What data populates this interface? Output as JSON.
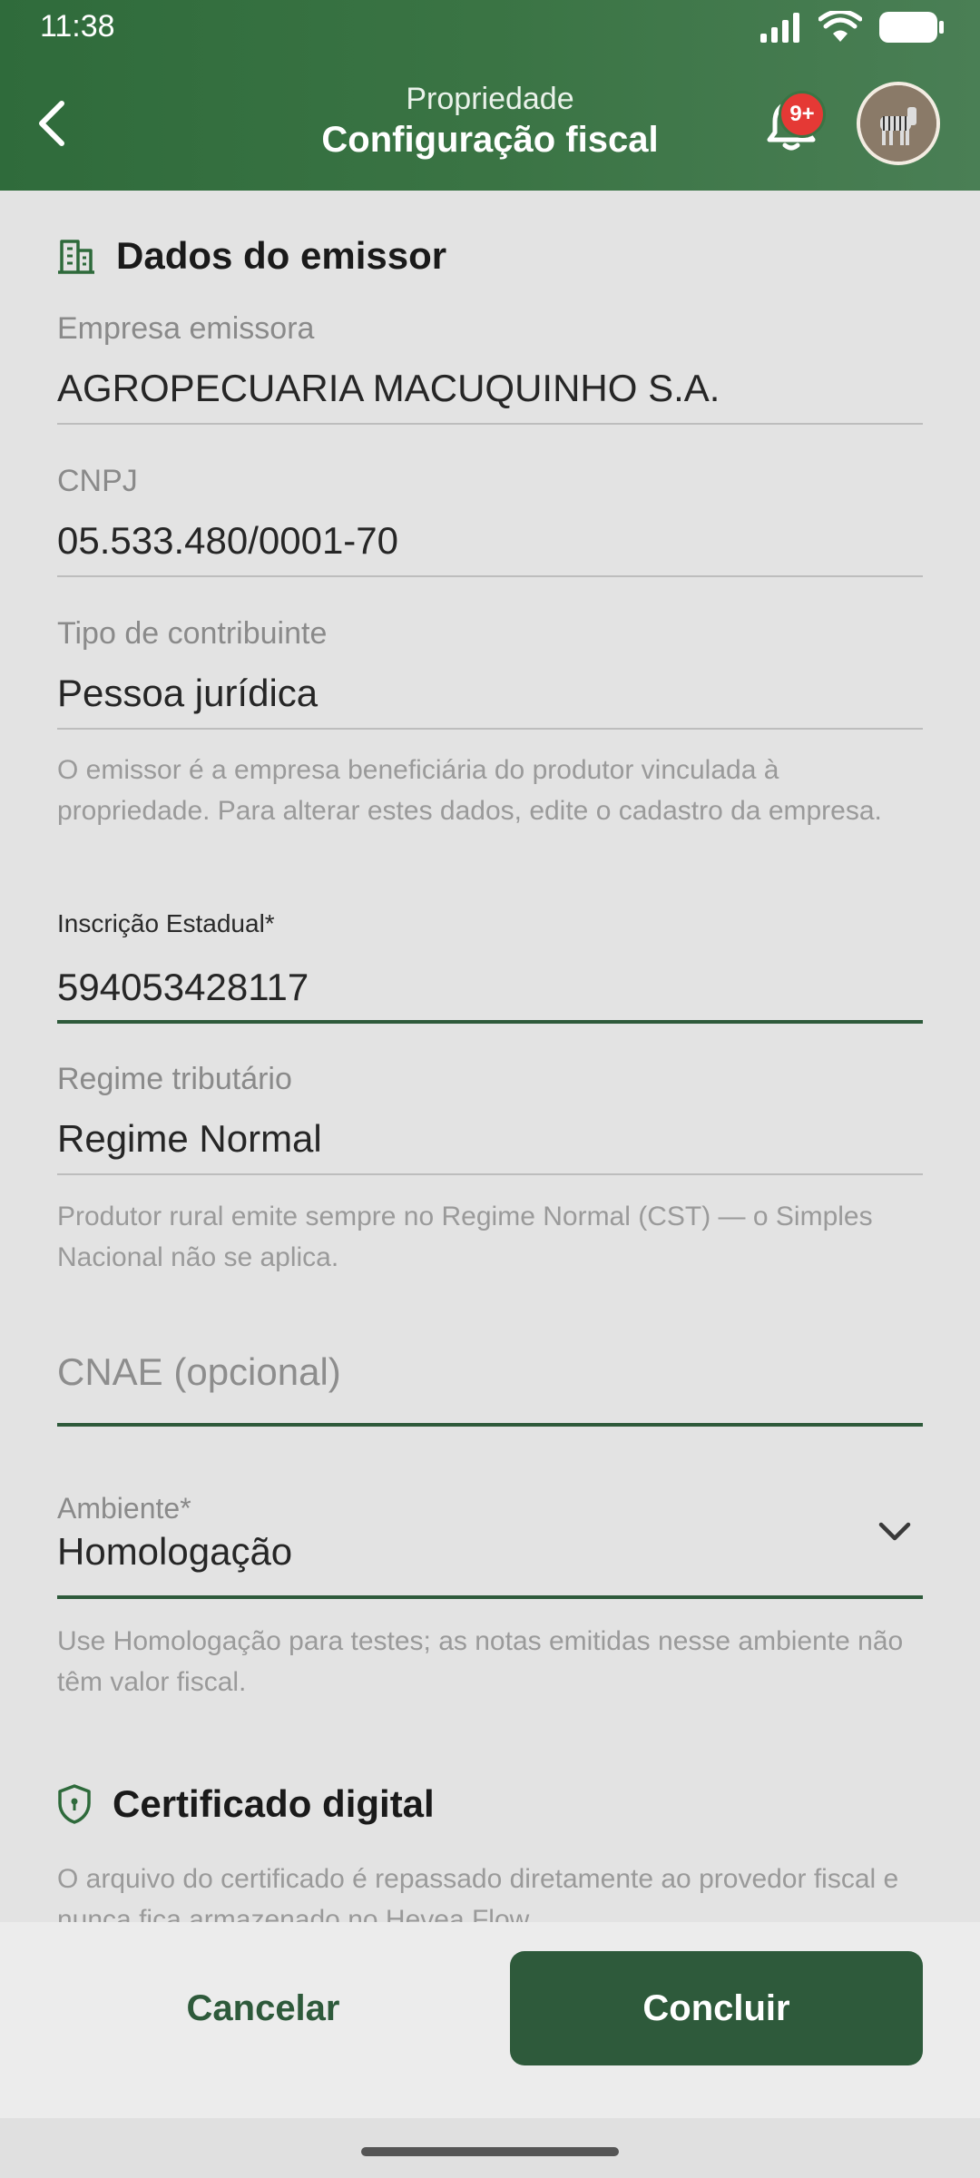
{
  "status": {
    "time": "11:38"
  },
  "header": {
    "subtitle": "Propriedade",
    "title": "Configuração fiscal",
    "notif_badge": "9+"
  },
  "sections": {
    "emissor_title": "Dados do emissor",
    "cert_title": "Certificado digital"
  },
  "fields": {
    "empresa": {
      "label": "Empresa emissora",
      "value": "AGROPECUARIA MACUQUINHO S.A."
    },
    "cnpj": {
      "label": "CNPJ",
      "value": "05.533.480/0001-70"
    },
    "tipo": {
      "label": "Tipo de contribuinte",
      "value": "Pessoa jurídica"
    },
    "ie": {
      "label": "Inscrição Estadual*",
      "value": "594053428117"
    },
    "regime": {
      "label": "Regime tributário",
      "value": "Regime Normal"
    },
    "cnae": {
      "placeholder": "CNAE (opcional)"
    },
    "ambiente": {
      "label": "Ambiente*",
      "value": "Homologação"
    }
  },
  "help": {
    "emissor": "O emissor é a empresa beneficiária do produtor vinculada à propriedade. Para alterar estes dados, edite o cadastro da empresa.",
    "regime": "Produtor rural emite sempre no Regime Normal (CST) — o Simples Nacional não se aplica.",
    "ambiente": "Use Homologação para testes; as notas emitidas nesse ambiente não têm valor fiscal.",
    "cert": "O arquivo do certificado é repassado diretamente ao provedor fiscal e nunca fica armazenado no Hevea Flow."
  },
  "actions": {
    "cancel": "Cancelar",
    "confirm": "Concluir"
  },
  "icons": [
    "signal-icon",
    "wifi-icon",
    "battery-icon",
    "back-arrow-icon",
    "bell-icon",
    "building-icon",
    "shield-icon",
    "chevron-down-icon"
  ],
  "colors": {
    "header": "#3a7444",
    "primary": "#2e5a3b",
    "badge": "#e53935"
  }
}
